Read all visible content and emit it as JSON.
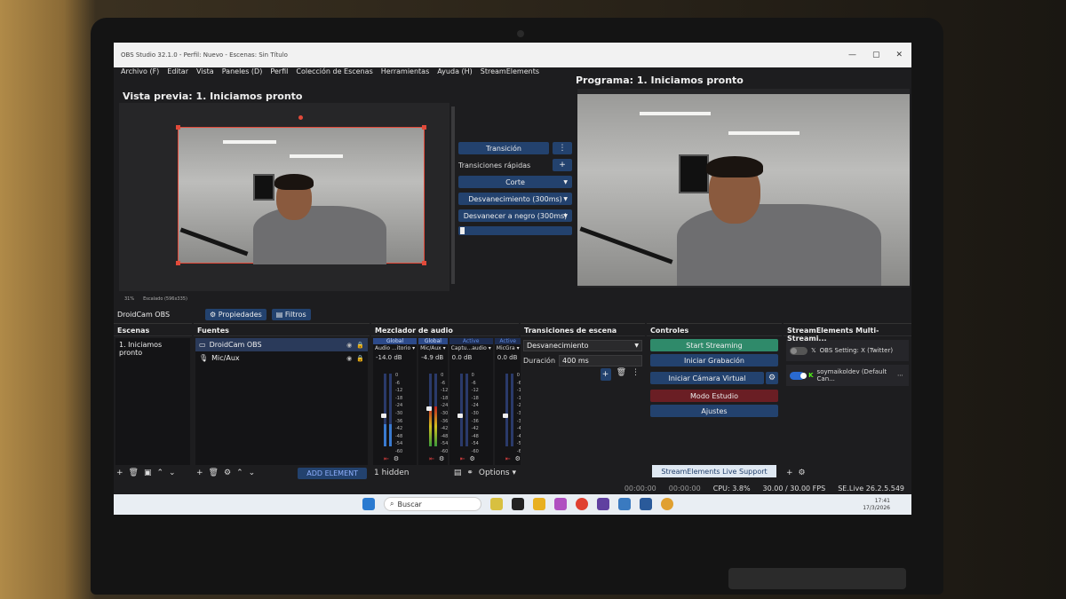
{
  "window": {
    "title": "OBS Studio 32.1.0 - Perfil: Nuevo - Escenas: Sin Título",
    "controls": [
      "—",
      "▢",
      "✕"
    ]
  },
  "menu": [
    "Archivo (F)",
    "Editar",
    "Vista",
    "Paneles (D)",
    "Perfil",
    "Colección de Escenas",
    "Herramientas",
    "Ayuda (H)",
    "StreamElements"
  ],
  "preview": {
    "title": "Vista previa: 1. Iniciamos pronto"
  },
  "program": {
    "title": "Programa: 1. Iniciamos pronto"
  },
  "transitions_panel": {
    "transition_label": "Transición",
    "more_icon": "⋮",
    "quick_label": "Transiciones rápidas",
    "add_icon": "+",
    "buttons": [
      "Corte",
      "Desvanecimiento (300ms)",
      "Desvanecer a negro (300ms)"
    ]
  },
  "zoom": {
    "value": "31%",
    "scaled": "Escalado (596x335)"
  },
  "source_bar": {
    "name": "DroidCam OBS",
    "properties": "Propiedades",
    "filters": "Filtros"
  },
  "scenes": {
    "title": "Escenas",
    "items": [
      "1. Iniciamos pronto"
    ]
  },
  "sources": {
    "title": "Fuentes",
    "items": [
      "DroidCam OBS",
      "Mic/Aux"
    ],
    "add_element": "ADD ELEMENT"
  },
  "mixer": {
    "title": "Mezclador de audio",
    "channels": [
      {
        "tag": "Global",
        "name": "Audio ...itorio",
        "db": "-14.0 dB",
        "level": 0.3,
        "active": false
      },
      {
        "tag": "Global",
        "name": "Mic/Aux",
        "db": "-4.9 dB",
        "level": 0.55,
        "active": false
      },
      {
        "tag": "Active",
        "name": "Captu...audio",
        "db": "0.0 dB",
        "level": 0.0,
        "active": true
      },
      {
        "tag": "Active",
        "name": "MicGra",
        "db": "0.0 dB",
        "level": 0.0,
        "active": true
      }
    ],
    "scale": [
      "0",
      "-6",
      "-12",
      "-18",
      "-24",
      "-30",
      "-36",
      "-42",
      "-48",
      "-54",
      "-60"
    ],
    "hidden": "1 hidden",
    "options": "Options"
  },
  "scene_transitions": {
    "title": "Transiciones de escena",
    "selected": "Desvanecimiento",
    "duration_label": "Duración",
    "duration_value": "400 ms"
  },
  "controls": {
    "title": "Controles",
    "start_streaming": "Start Streaming",
    "start_recording": "Iniciar Grabación",
    "virtual_cam": "Iniciar Cámara Virtual",
    "studio_mode": "Modo Estudio",
    "settings": "Ajustes",
    "support": "StreamElements Live Support"
  },
  "se_panel": {
    "title": "StreamElements Multi-Streami...",
    "items": [
      {
        "label": "OBS Setting: X (Twitter)",
        "enabled": false
      },
      {
        "label": "soymaikoldev (Default Can...",
        "enabled": true
      }
    ]
  },
  "status": {
    "rec_time": "00:00:00",
    "stream_time": "00:00:00",
    "cpu": "CPU: 3.8%",
    "fps": "30.00 / 30.00 FPS",
    "version": "SE.Live 26.2.5.549"
  },
  "taskbar": {
    "search": "Buscar",
    "time": "17:41",
    "date": "17/3/2026"
  },
  "colors": {
    "accent": "#23426e",
    "green": "#2f8a6a",
    "maroon": "#6a1e24",
    "selection": "#e24a3a"
  }
}
